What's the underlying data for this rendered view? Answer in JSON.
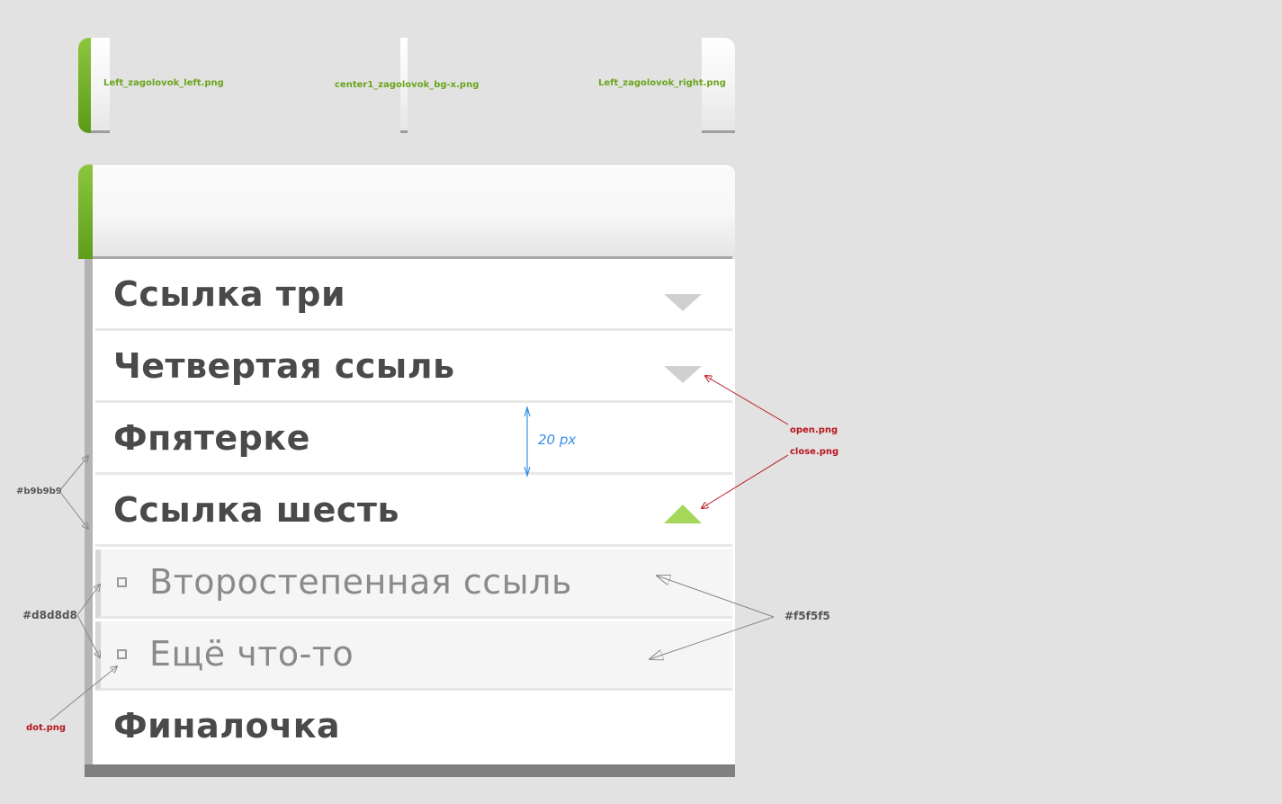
{
  "sprite_files": {
    "left": "Left_zagolovok_left.png",
    "center": "center1_zagolovok_bg-x.png",
    "right": "Left_zagolovok_right.png"
  },
  "menu": {
    "items": [
      {
        "label": "Ссылка три",
        "state": "collapsed",
        "icon": "open-triangle-icon"
      },
      {
        "label": "Четвертая ссыль",
        "state": "collapsed",
        "icon": "open-triangle-icon"
      },
      {
        "label": "Фпятерке",
        "state": "none"
      },
      {
        "label": "Ссылка шесть",
        "state": "expanded",
        "icon": "close-triangle-icon"
      }
    ],
    "sub_items": [
      {
        "label": "Второстепенная ссыль",
        "icon": "dot-icon"
      },
      {
        "label": "Ещё что-то",
        "icon": "dot-icon"
      }
    ],
    "last_item": {
      "label": "Финалочка"
    }
  },
  "annotations": {
    "open_png": "open.png",
    "close_png": "close.png",
    "dot_png": "dot.png",
    "border_color_label": "#b9b9b9",
    "sub_border_color_label": "#d8d8d8",
    "sub_bg_color_label": "#f5f5f5",
    "row_height": "20 px"
  },
  "colors": {
    "background": "#e2e2e2",
    "accent_green": "#8cc63f",
    "text_dark": "#4a4a4a",
    "text_sub": "#8a8a8a",
    "menu_left_border": "#b9b9b9",
    "sub_border": "#d8d8d8",
    "sub_background": "#f5f5f5",
    "open_arrow": "#d0d0d0",
    "close_arrow": "#a5d75a",
    "annotation_red": "#b8141d",
    "dimension_blue": "#3a8ee6"
  }
}
